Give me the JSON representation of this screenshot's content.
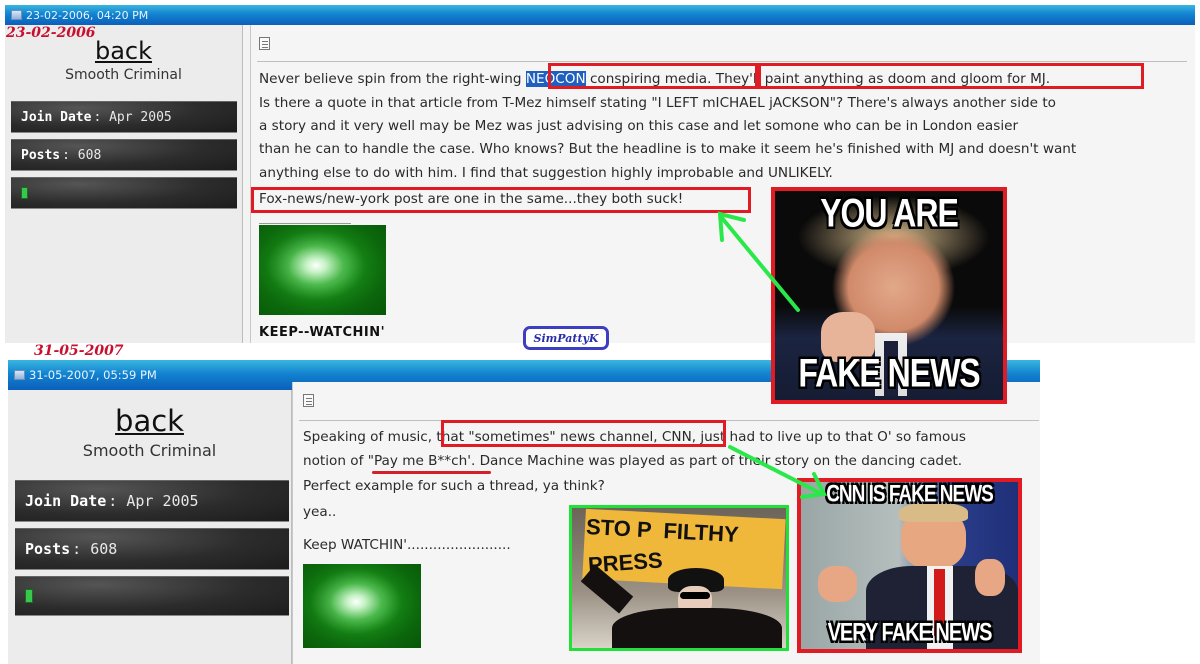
{
  "post1": {
    "timestamp": "23-02-2006, 04:20 PM",
    "annotation_date": "23-02-2006",
    "user": {
      "name": "back",
      "title": "Smooth Criminal",
      "join_label": "Join Date",
      "join_value": "Apr 2005",
      "posts_label": "Posts",
      "posts_value": "608",
      "status": "online"
    },
    "body": {
      "line1_a": "Never believe spin from the right-wing ",
      "line1_hl": "NEOCON",
      "line1_b": " conspiring media. ",
      "line1_c": "They'll paint anything as doom and gloom for MJ.",
      "line2": "Is there a quote in that article from T-Mez himself stating \"I LEFT mICHAEL jACKSON\"? There's always another side to",
      "line3": "a story and it very well may be Mez was just advising on this case and let somone who can be in London easier",
      "line4": "than he can to handle the case. Who knows? But the headline is to make it seem he's finished with MJ and doesn't want",
      "line5": "anything else to do with him. I find that suggestion highly improbable and UNLIKELY.",
      "line6": "Fox-news/new-york post are one in the same...they both suck!"
    },
    "signature_text": "KEEP--WATCHIN'"
  },
  "watermark": "SimPattyK",
  "meme1": {
    "top": "YOU ARE",
    "bottom": "FAKE NEWS"
  },
  "post2": {
    "timestamp": "31-05-2007, 05:59 PM",
    "annotation_date": "31-05-2007",
    "user": {
      "name": "back",
      "title": "Smooth Criminal",
      "join_label": "Join Date",
      "join_value": "Apr 2005",
      "posts_label": "Posts",
      "posts_value": "608",
      "status": "online"
    },
    "body": {
      "line1_a": "Speaking of music, ",
      "line1_box": "that \"sometimes\" news channel, CNN,",
      "line1_b": " just had to live up to that O' so famous",
      "line2_a": "notion of ",
      "line2_ul": "\"Pay me B**ch'",
      "line2_b": ". Dance Machine was played as part of their story  on the dancing cadet.",
      "line3": "Perfect example for such a thread, ya think?",
      "line4": "yea..",
      "line5": "Keep WATCHIN'........................"
    }
  },
  "photo": {
    "sign_line1": "STO P  FILTHY",
    "sign_line2": "PRESS"
  },
  "meme2": {
    "top": "CNN IS FAKE NEWS",
    "bottom": "VERY FAKE NEWS"
  },
  "colors": {
    "annotation_red": "#e01b24",
    "annotation_green": "#22e03a",
    "titlebar_blue": "#1383d0",
    "watermark_blue": "#3d3fbf"
  }
}
